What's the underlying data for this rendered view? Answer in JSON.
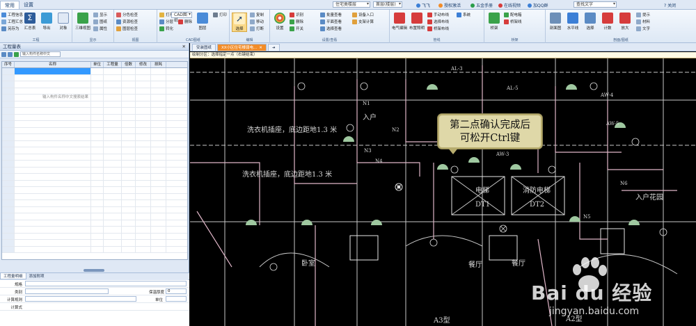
{
  "title_bar": {
    "tabs": [
      "常用",
      "设置"
    ],
    "combo_building": "住宅类楼层",
    "combo_floor": "首层(楼层)",
    "links": [
      "飞飞",
      "授权激活",
      "五金手册",
      "在线视频",
      "加QQ群"
    ],
    "search_placeholder": "查找文字",
    "help": "? 关闭"
  },
  "ribbon": {
    "groups": [
      {
        "title": "工程",
        "items": [
          "工程信息",
          "工程汇总",
          "另存为",
          "汇总表",
          "导出",
          "对象"
        ]
      },
      {
        "title": "显示",
        "items": [
          "三维视图",
          "显示",
          "图纸",
          "属性"
        ]
      },
      {
        "title": "视图",
        "items": [
          "分色检查",
          "资源检查",
          "图层检查"
        ]
      },
      {
        "title": "CAD图纸",
        "items": [
          "打开",
          "CAD图纸",
          "分层",
          "转化",
          "删除",
          "图层",
          "打印"
        ]
      },
      {
        "title": "编辑",
        "items": [
          "选择",
          "复制",
          "移动",
          "删除",
          "偏移",
          "打断"
        ]
      },
      {
        "title": "设置/查看",
        "items": [
          "设置",
          "识别",
          "删除",
          "开关",
          "批量查看",
          "平面查看",
          "选择查看",
          "设备入口",
          "支架计算"
        ]
      },
      {
        "title": "管线",
        "items": [
          "电气编辑",
          "布置照明",
          "手动布线",
          "选择布线",
          "桥架布线",
          "系统"
        ]
      },
      {
        "title": "桥架",
        "items": [
          "桥架",
          "配电箱",
          "桥架线"
        ]
      },
      {
        "title": "剖面/图纸",
        "items": [
          "剖面图",
          "水平线",
          "选择",
          "计数",
          "放大",
          "提示",
          "材料",
          "文字"
        ]
      }
    ]
  },
  "left_panel": {
    "title": "工程量表",
    "search_placeholder": "输入构件名称中文",
    "columns": [
      "序号",
      "名称",
      "单位",
      "工程量",
      "倍数",
      "修改",
      "损耗"
    ],
    "empty_hint": "输入构件名称中文搜索结果",
    "bottom_tabs": [
      "工程量明细",
      "添加附项"
    ],
    "properties": [
      {
        "label": "规格",
        "value": ""
      },
      {
        "label": "类别",
        "value": "",
        "extra_label": "保温厚度",
        "extra_value": "0"
      },
      {
        "label": "计算规则",
        "value": "",
        "extra_label": "单位",
        "extra_value": ""
      },
      {
        "label": "计算式",
        "value": ""
      }
    ]
  },
  "doc_tabs": [
    "安装图纸",
    "XX小区住宅楼弱电..."
  ],
  "hint_bar": "绘制分区：选择指定一点（右键结束）",
  "canvas": {
    "callout_line1": "第二点确认完成后",
    "callout_line2": "可松开Ctrl键",
    "labels": {
      "wash1": "洗衣机插座，底边距地1.3 米",
      "wash2": "洗衣机插座，底边距地1.3 米",
      "dt1": "DT1",
      "dt2": "DT2",
      "elev": "电梯",
      "fire_elev": "消防电梯",
      "bedroom": "卧室",
      "dining": "餐厅",
      "bedroom2": "餐厅",
      "entry": "入户花园",
      "entry2": "入户",
      "type_a3": "A3型",
      "type_a2": "A2型",
      "ale3": "AL-3",
      "ale5": "AL-5",
      "aw3": "AW-3",
      "aw4": "AW-4",
      "aw5": "AW-5",
      "n1": "N1",
      "n2": "N2",
      "n3": "N3",
      "n4": "N4",
      "n5": "N5",
      "n6": "N6"
    },
    "watermark_main": "Bai du 经验",
    "watermark_url": "jingyan.baidu.com"
  },
  "colors": {
    "ribbon_bg": "#dde8f5",
    "accent_orange": "#f28c28",
    "selection_blue": "#3399ff",
    "cad_line": "#e0b6c8",
    "cad_wire": "#c8c8c8",
    "cad_fill": "#9fc8a0"
  }
}
